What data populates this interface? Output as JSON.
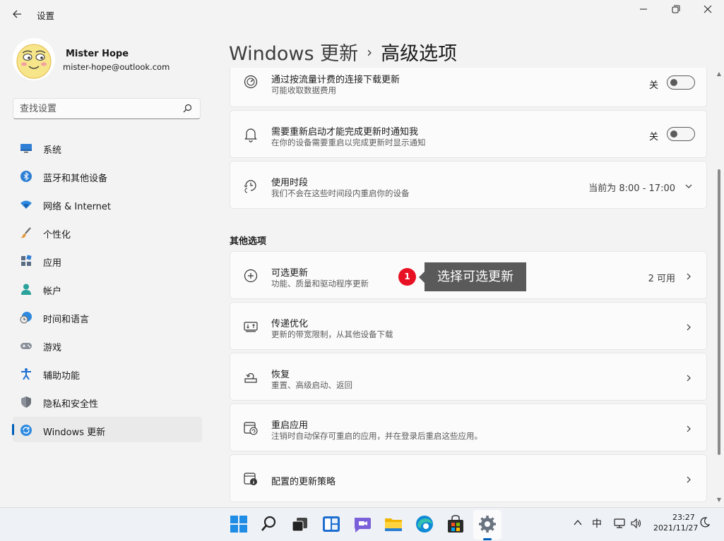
{
  "window": {
    "title": "设置",
    "back_icon": "back-arrow-icon",
    "minimize_glyph": "—",
    "maximize_glyph": "❐",
    "close_glyph": "✕"
  },
  "profile": {
    "name": "Mister Hope",
    "email": "mister-hope@outlook.com"
  },
  "search": {
    "placeholder": "查找设置"
  },
  "sidebar": {
    "items": [
      {
        "label": "系统",
        "icon": "monitor-icon",
        "active": false
      },
      {
        "label": "蓝牙和其他设备",
        "icon": "bluetooth-icon",
        "active": false
      },
      {
        "label": "网络 & Internet",
        "icon": "wifi-icon",
        "active": false
      },
      {
        "label": "个性化",
        "icon": "brush-icon",
        "active": false
      },
      {
        "label": "应用",
        "icon": "apps-icon",
        "active": false
      },
      {
        "label": "帐户",
        "icon": "person-icon",
        "active": false
      },
      {
        "label": "时间和语言",
        "icon": "clock-globe-icon",
        "active": false
      },
      {
        "label": "游戏",
        "icon": "gamepad-icon",
        "active": false
      },
      {
        "label": "辅助功能",
        "icon": "accessibility-icon",
        "active": false
      },
      {
        "label": "隐私和安全性",
        "icon": "shield-icon",
        "active": false
      },
      {
        "label": "Windows 更新",
        "icon": "update-icon",
        "active": true
      }
    ]
  },
  "breadcrumb": {
    "parent": "Windows 更新",
    "separator": "›",
    "current": "高级选项"
  },
  "settings": {
    "metered": {
      "title": "通过按流量计费的连接下载更新",
      "subtitle": "可能收取数据费用",
      "state": "关",
      "icon": "gauge-icon"
    },
    "notify_restart": {
      "title": "需要重新启动才能完成更新时通知我",
      "subtitle": "在你的设备需要重启以完成更新时显示通知",
      "state": "关",
      "icon": "bell-icon"
    },
    "active_hours": {
      "title": "使用时段",
      "subtitle": "我们不会在这些时间段内重启你的设备",
      "value": "当前为 8:00 - 17:00",
      "icon": "clock-update-icon"
    }
  },
  "other_options": {
    "heading": "其他选项",
    "items": [
      {
        "title": "可选更新",
        "subtitle": "功能、质量和驱动程序更新",
        "value": "2 可用",
        "icon": "plus-circle-icon"
      },
      {
        "title": "传递优化",
        "subtitle": "更新的带宽限制，从其他设备下载",
        "value": "",
        "icon": "delivery-optimization-icon"
      },
      {
        "title": "恢复",
        "subtitle": "重置、高级启动、返回",
        "value": "",
        "icon": "recovery-icon"
      },
      {
        "title": "重启应用",
        "subtitle": "注销时自动保存可重启的应用，并在登录后重启这些应用。",
        "value": "",
        "icon": "restart-apps-icon"
      },
      {
        "title": "配置的更新策略",
        "subtitle": "",
        "value": "",
        "icon": "policy-icon"
      }
    ]
  },
  "annotation": {
    "number": "1",
    "text": "选择可选更新"
  },
  "taskbar": {
    "apps": [
      "start-icon",
      "search-icon",
      "task-view-icon",
      "widgets-icon",
      "chat-icon",
      "file-explorer-icon",
      "edge-icon",
      "store-icon",
      "settings-icon"
    ],
    "tray": {
      "chevron": "^",
      "ime": "中",
      "time": "23:27",
      "date": "2021/11/27"
    }
  },
  "colors": {
    "accent": "#005fb8",
    "badge": "#e81123",
    "callout_bg": "#5a5a5a"
  }
}
